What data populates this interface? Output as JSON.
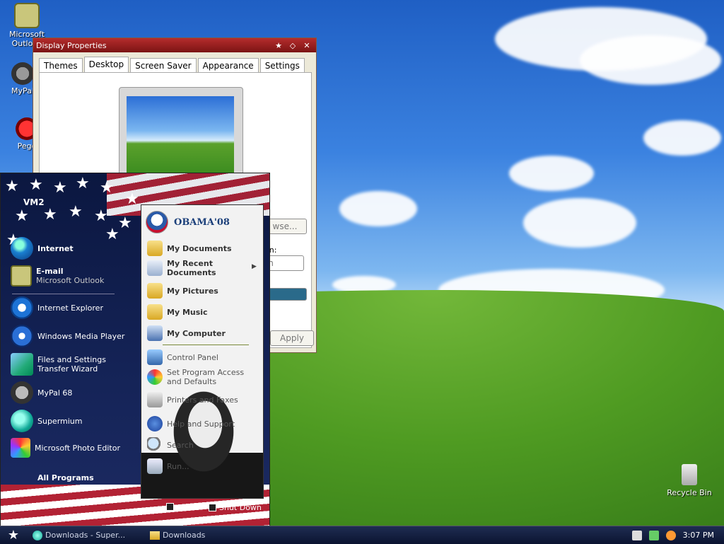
{
  "desktop": {
    "icons": [
      {
        "label": "Microsoft Outlook",
        "icon": "outlook-icon"
      },
      {
        "label": "MyPal",
        "icon": "raccoon-icon"
      },
      {
        "label": "Pego",
        "icon": "pego-icon"
      }
    ],
    "recycle_bin": "Recycle Bin"
  },
  "window": {
    "title": "Display Properties",
    "tabs": [
      "Themes",
      "Desktop",
      "Screen Saver",
      "Appearance",
      "Settings"
    ],
    "active_tab": "Desktop",
    "browse_label": "wse...",
    "position_label": "on:",
    "position_value": "sh",
    "apply_label": "Apply"
  },
  "start_menu": {
    "user": "VM2",
    "pinned": [
      {
        "title": "Internet",
        "icon": "globe-icon"
      },
      {
        "title": "E-mail",
        "subtitle": "Microsoft Outlook",
        "icon": "outlook-icon"
      }
    ],
    "recent": [
      {
        "title": "Internet Explorer",
        "icon": "ie-icon"
      },
      {
        "title": "Windows Media Player",
        "icon": "media-player-icon"
      },
      {
        "title": "Files and Settings Transfer Wizard",
        "icon": "transfer-wizard-icon"
      },
      {
        "title": "MyPal 68",
        "icon": "raccoon-icon"
      },
      {
        "title": "Supermium",
        "icon": "supermium-icon"
      },
      {
        "title": "Microsoft Photo Editor",
        "icon": "photo-editor-icon"
      }
    ],
    "all_programs": "All Programs",
    "logo_text": "OBAMA'08",
    "right_items": [
      {
        "title": "My Documents",
        "icon": "folder-icon"
      },
      {
        "title": "My Recent Documents",
        "icon": "recent-docs-icon"
      },
      {
        "title": "My Pictures",
        "icon": "pictures-icon"
      },
      {
        "title": "My Music",
        "icon": "music-icon"
      },
      {
        "title": "My Computer",
        "icon": "computer-icon"
      }
    ],
    "right_items_2": [
      {
        "title": "Control Panel",
        "icon": "control-panel-icon"
      },
      {
        "title": "Set Program Access and Defaults",
        "icon": "program-access-icon"
      },
      {
        "title": "Printers and Faxes",
        "icon": "printer-icon"
      },
      {
        "title": "Help and Support",
        "icon": "help-icon"
      },
      {
        "title": "Search",
        "icon": "search-icon"
      },
      {
        "title": "Run...",
        "icon": "run-icon"
      }
    ],
    "shutdown_label": "Shut Down"
  },
  "taskbar": {
    "tasks": [
      {
        "label": "Downloads - Super...",
        "icon": "supermium-icon"
      },
      {
        "label": "Downloads",
        "icon": "folder-icon"
      }
    ],
    "clock": "3:07 PM"
  },
  "colors": {
    "flag_red": "#b22234",
    "flag_blue": "#0b1740",
    "title_red": "#b52c2c"
  }
}
